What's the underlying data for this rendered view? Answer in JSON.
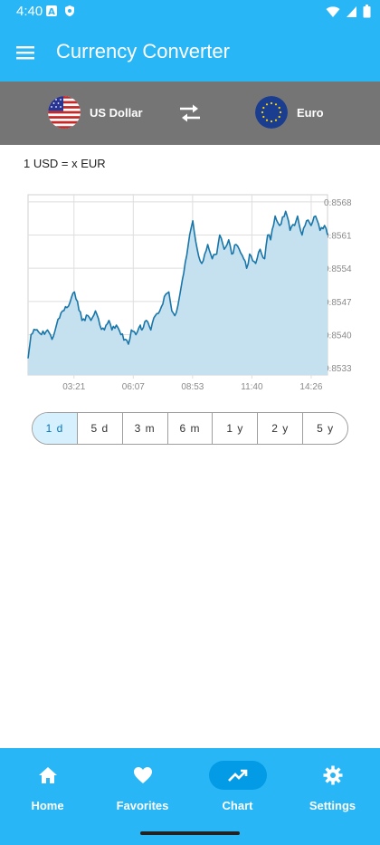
{
  "status_bar": {
    "time": "4:40",
    "left_icons": [
      "a-icon",
      "shield-icon"
    ],
    "right_icons": [
      "wifi-icon",
      "signal-icon",
      "battery-icon"
    ]
  },
  "app_bar": {
    "title": "Currency Converter",
    "menu_icon": "menu-icon"
  },
  "converter": {
    "from": {
      "label": "US Dollar",
      "flag": "us-flag-icon"
    },
    "to": {
      "label": "Euro",
      "flag": "eu-flag-icon"
    },
    "swap_icon": "swap-arrows-icon"
  },
  "rate_label": "1 USD = x EUR",
  "chart_data": {
    "type": "area",
    "title": "",
    "xlabel": "",
    "ylabel": "",
    "x_ticks": [
      "03:21",
      "06:07",
      "08:53",
      "11:40",
      "14:26"
    ],
    "y_ticks": [
      "0.8568",
      "0.8561",
      "0.8554",
      "0.8547",
      "0.8540",
      "0.8533"
    ],
    "ylim": [
      0.85315,
      0.85695
    ],
    "xlim": [
      0,
      1000
    ],
    "series": [
      {
        "color": "#1976a8",
        "fill": "#c5e1f0",
        "x": [
          0,
          10,
          25,
          45,
          65,
          80,
          95,
          115,
          135,
          155,
          165,
          180,
          200,
          210,
          225,
          240,
          255,
          270,
          280,
          295,
          310,
          325,
          335,
          345,
          360,
          375,
          380,
          395,
          410,
          425,
          440,
          455,
          470,
          480,
          490,
          500,
          520,
          535,
          550,
          565,
          580,
          590,
          600,
          615,
          630,
          640,
          655,
          670,
          680,
          695,
          705,
          720,
          730,
          740,
          760,
          775,
          790,
          800,
          810,
          825,
          840,
          860,
          875,
          890,
          900,
          915,
          930,
          945,
          960,
          975,
          990,
          1000
        ],
        "values": [
          0.8535,
          0.854,
          0.8541,
          0.854,
          0.8541,
          0.8539,
          0.8542,
          0.8545,
          0.8546,
          0.8549,
          0.8547,
          0.8543,
          0.8544,
          0.8543,
          0.8545,
          0.8542,
          0.8541,
          0.8543,
          0.8541,
          0.8542,
          0.854,
          0.8539,
          0.8538,
          0.8541,
          0.854,
          0.8542,
          0.8541,
          0.8543,
          0.8541,
          0.8544,
          0.8545,
          0.8548,
          0.8549,
          0.8545,
          0.8544,
          0.8546,
          0.8553,
          0.8559,
          0.8564,
          0.8558,
          0.8555,
          0.8557,
          0.8559,
          0.8556,
          0.8557,
          0.8561,
          0.8558,
          0.856,
          0.8557,
          0.8559,
          0.8558,
          0.8556,
          0.8554,
          0.8557,
          0.8555,
          0.8558,
          0.8556,
          0.8561,
          0.856,
          0.8565,
          0.8563,
          0.8566,
          0.8562,
          0.8563,
          0.8565,
          0.8561,
          0.8564,
          0.8563,
          0.8565,
          0.8562,
          0.8563,
          0.8561
        ]
      }
    ],
    "grid": true
  },
  "ranges": {
    "items": [
      "1 d",
      "5 d",
      "3 m",
      "6 m",
      "1 y",
      "2 y",
      "5 y"
    ],
    "active_index": 0
  },
  "bottom_nav": {
    "items": [
      {
        "label": "Home",
        "icon": "home-icon"
      },
      {
        "label": "Favorites",
        "icon": "heart-icon"
      },
      {
        "label": "Chart",
        "icon": "trending-up-icon"
      },
      {
        "label": "Settings",
        "icon": "gear-icon"
      }
    ],
    "active_index": 2
  }
}
